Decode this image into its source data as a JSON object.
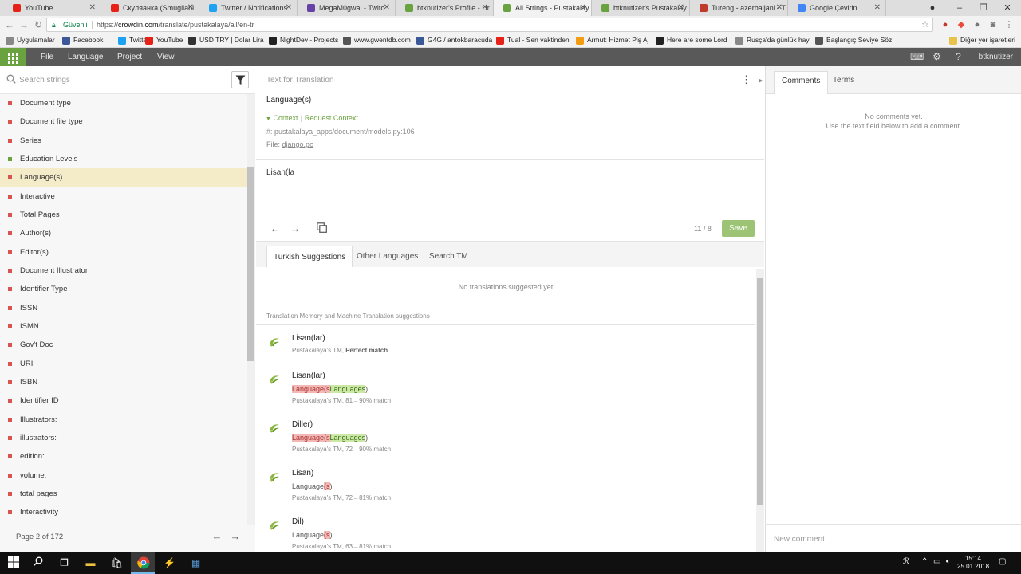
{
  "browser": {
    "tabs": [
      {
        "title": "YouTube",
        "color": "#e62117"
      },
      {
        "title": "Скуляанка (Smugliani...",
        "color": "#e62117"
      },
      {
        "title": "Twitter / Notifications",
        "color": "#1da1f2"
      },
      {
        "title": "MegaM0gwai - Twitc",
        "color": "#6441a5"
      },
      {
        "title": "btknutizer's Profile - Ur",
        "color": "#6aa23f"
      },
      {
        "title": "All Strings - Pustakalay",
        "color": "#6aa23f"
      },
      {
        "title": "btknutizer's Pustakalay",
        "color": "#6aa23f"
      },
      {
        "title": "Tureng - azerbaijani - T",
        "color": "#c0392b"
      },
      {
        "title": "Google Çevirin",
        "color": "#4285f4"
      }
    ],
    "secure_label": "Güvenli",
    "url_prefix": "https://",
    "url_host": "crowdin.com",
    "url_path": "/translate/pustakalaya/all/en-tr",
    "bookmarks": [
      {
        "label": "Uygulamalar",
        "color": "#888"
      },
      {
        "label": "Facebook",
        "color": "#3b5998"
      },
      {
        "label": "Twitter",
        "color": "#1da1f2"
      },
      {
        "label": "YouTube",
        "color": "#e62117"
      },
      {
        "label": "USD TRY | Dolar Lira",
        "color": "#333"
      },
      {
        "label": "NightDev - Projects",
        "color": "#222"
      },
      {
        "label": "www.gwentdb.com",
        "color": "#555"
      },
      {
        "label": "G4G / antokbaracuda",
        "color": "#3b5998"
      },
      {
        "label": "Tual - Sen vaktinden",
        "color": "#e62117"
      },
      {
        "label": "Armut: Hizmet Piş Aj",
        "color": "#f39c12"
      },
      {
        "label": "Here are some Lord",
        "color": "#222"
      },
      {
        "label": "Rusça'da günlük hay",
        "color": "#888"
      },
      {
        "label": "Başlangıç Seviye Söz",
        "color": "#555"
      },
      {
        "label": "Diğer yer işaretleri",
        "color": "#e8c34a"
      }
    ]
  },
  "app": {
    "menu": [
      "File",
      "Language",
      "Project",
      "View"
    ],
    "username": "btknutizer"
  },
  "left": {
    "search_placeholder": "Search strings",
    "items": [
      {
        "label": "Document type",
        "status": "red"
      },
      {
        "label": "Document file type",
        "status": "red"
      },
      {
        "label": "Series",
        "status": "red"
      },
      {
        "label": "Education Levels",
        "status": "green"
      },
      {
        "label": "Language(s)",
        "status": "red",
        "active": true
      },
      {
        "label": "Interactive",
        "status": "red"
      },
      {
        "label": "Total Pages",
        "status": "red"
      },
      {
        "label": "Author(s)",
        "status": "red"
      },
      {
        "label": "Editor(s)",
        "status": "red"
      },
      {
        "label": "Document Illustrator",
        "status": "red"
      },
      {
        "label": "Identifier Type",
        "status": "red"
      },
      {
        "label": "ISSN",
        "status": "red"
      },
      {
        "label": "ISMN",
        "status": "red"
      },
      {
        "label": "Gov't Doc",
        "status": "red"
      },
      {
        "label": "URI",
        "status": "red"
      },
      {
        "label": "ISBN",
        "status": "red"
      },
      {
        "label": "Identifier ID",
        "status": "red"
      },
      {
        "label": "Illustrators:",
        "status": "red"
      },
      {
        "label": "illustrators:",
        "status": "red"
      },
      {
        "label": "edition:",
        "status": "red"
      },
      {
        "label": "volume:",
        "status": "red"
      },
      {
        "label": "total pages",
        "status": "red"
      },
      {
        "label": "Interactivity",
        "status": "red"
      }
    ],
    "pager": "Page 2 of 172"
  },
  "editor": {
    "source_label": "Text for Translation",
    "source_text": "Language(s)",
    "context_label": "Context",
    "request_context": "Request Context",
    "ref": "#: pustakalaya_apps/document/models.py:106",
    "file_label": "File:",
    "file_name": "django.po",
    "translation": "Lisan(la",
    "counter": "11 / 8",
    "save": "Save",
    "tabs": [
      "Turkish Suggestions",
      "Other Languages",
      "Search TM"
    ],
    "no_suggestions": "No translations suggested yet",
    "tm_header": "Translation Memory and Machine Translation suggestions",
    "tm": [
      {
        "text": "Lisan(lar)",
        "diff": [],
        "src": "Pustakalaya's TM,",
        "match": "Perfect match"
      },
      {
        "text": "Lisan(lar)",
        "diff": [
          {
            "t": "del",
            "v": "Language(s"
          },
          {
            "t": "ins",
            "v": "Languages"
          },
          {
            "t": "eq",
            "v": ")"
          }
        ],
        "src": "Pustakalaya's TM, 81→90% match",
        "match": ""
      },
      {
        "text": "Diller)",
        "diff": [
          {
            "t": "del",
            "v": "Language(s"
          },
          {
            "t": "ins",
            "v": "Languages"
          },
          {
            "t": "eq",
            "v": ")"
          }
        ],
        "src": "Pustakalaya's TM, 72→90% match",
        "match": ""
      },
      {
        "text": "Lisan)",
        "diff": [
          {
            "t": "eq",
            "v": "Language"
          },
          {
            "t": "del",
            "v": "(s"
          },
          {
            "t": "eq",
            "v": ")"
          }
        ],
        "src": "Pustakalaya's TM, 72→81% match",
        "match": ""
      },
      {
        "text": "Dil)",
        "diff": [
          {
            "t": "eq",
            "v": "Language"
          },
          {
            "t": "del",
            "v": "(s"
          },
          {
            "t": "eq",
            "v": ")"
          }
        ],
        "src": "Pustakalaya's TM, 63→81% match",
        "match": ""
      }
    ]
  },
  "right": {
    "tabs": [
      "Comments",
      "Terms"
    ],
    "no_comments": "No comments yet.",
    "no_comments_hint": "Use the text field below to add a comment.",
    "new_comment_placeholder": "New comment"
  },
  "taskbar": {
    "time": "15:14",
    "date": "25.01.2018"
  }
}
